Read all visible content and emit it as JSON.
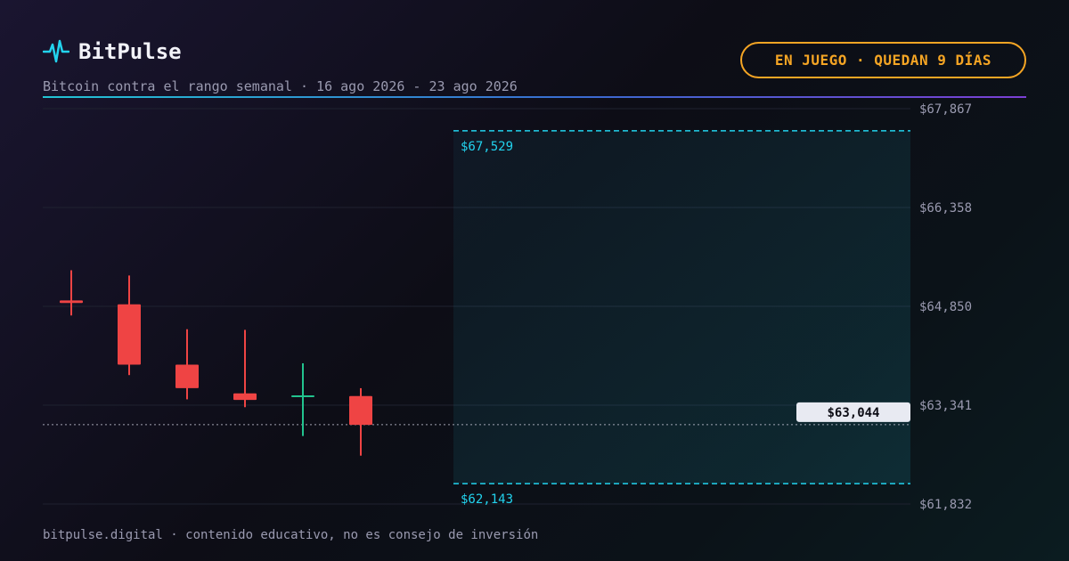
{
  "brand": {
    "name": "BitPulse",
    "icon": "pulse-icon",
    "accent": "#22d3ee"
  },
  "subtitle": "Bitcoin contra el rango semanal · 16 ago 2026 - 23 ago 2026",
  "status_badge": {
    "label": "EN JUEGO · QUEDAN 9 DÍAS",
    "color": "#f5a524"
  },
  "footer": "bitpulse.digital · contenido educativo, no es consejo de inversión",
  "chart_data": {
    "type": "candlestick",
    "ylim": [
      61832,
      67867
    ],
    "y_ticks": [
      {
        "value": 67867,
        "label": "$67,867"
      },
      {
        "value": 66358,
        "label": "$66,358"
      },
      {
        "value": 64850,
        "label": "$64,850"
      },
      {
        "value": 63341,
        "label": "$63,341"
      },
      {
        "value": 61832,
        "label": "$61,832"
      }
    ],
    "candles": [
      {
        "open": 64940,
        "high": 65400,
        "low": 64710,
        "close": 64900
      },
      {
        "open": 64880,
        "high": 65320,
        "low": 63800,
        "close": 63960
      },
      {
        "open": 63960,
        "high": 64500,
        "low": 63430,
        "close": 63600
      },
      {
        "open": 63520,
        "high": 64490,
        "low": 63310,
        "close": 63420
      },
      {
        "open": 63480,
        "high": 63980,
        "low": 62870,
        "close": 63490
      },
      {
        "open": 63480,
        "high": 63600,
        "low": 62570,
        "close": 63040
      }
    ],
    "range": {
      "upper": 67529,
      "upper_label": "$67,529",
      "lower": 62143,
      "lower_label": "$62,143",
      "color": "#22d3ee"
    },
    "current_price": {
      "value": 63044,
      "label": "$63,044"
    },
    "colors": {
      "up": "#22c38e",
      "down": "#ef4444",
      "grid": "#1f2230",
      "axis_text": "#9a9ab0"
    }
  }
}
